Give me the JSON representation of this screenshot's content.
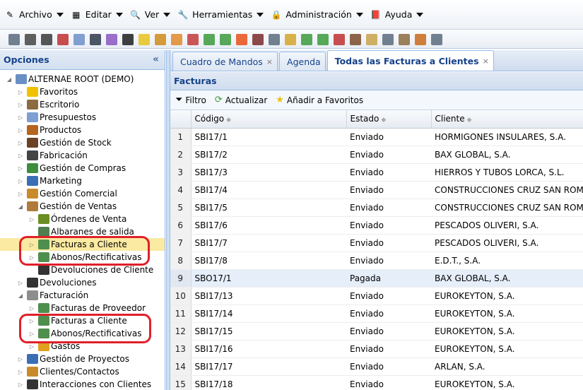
{
  "menubar": [
    {
      "label": "Archivo",
      "icon": "archivo-icon"
    },
    {
      "label": "Editar",
      "icon": "editar-icon"
    },
    {
      "label": "Ver",
      "icon": "ver-icon"
    },
    {
      "label": "Herramientas",
      "icon": "herramientas-icon"
    },
    {
      "label": "Administración",
      "icon": "lock-icon"
    },
    {
      "label": "Ayuda",
      "icon": "book-icon"
    }
  ],
  "left_panel": {
    "title": "Opciones",
    "collapse_glyph": "«"
  },
  "tree": [
    {
      "label": "ALTERNAE ROOT (DEMO)",
      "level": 0,
      "toggle": "◢",
      "icon": "database-icon",
      "color": "#6a8fc4"
    },
    {
      "label": "Favoritos",
      "level": 1,
      "toggle": "▷",
      "icon": "star-icon",
      "color": "#f2c200"
    },
    {
      "label": "Escritorio",
      "level": 1,
      "toggle": "▷",
      "icon": "desk-icon",
      "color": "#8b6b3f"
    },
    {
      "label": "Presupuestos",
      "level": 1,
      "toggle": "▷",
      "icon": "document-icon",
      "color": "#7d9fd1"
    },
    {
      "label": "Productos",
      "level": 1,
      "toggle": "▷",
      "icon": "products-icon",
      "color": "#b5651d"
    },
    {
      "label": "Gestión de Stock",
      "level": 1,
      "toggle": "▷",
      "icon": "stock-icon",
      "color": "#6b4226"
    },
    {
      "label": "Fabricación",
      "level": 1,
      "toggle": "▷",
      "icon": "factory-icon",
      "color": "#444444"
    },
    {
      "label": "Gestión de Compras",
      "level": 1,
      "toggle": "▷",
      "icon": "purchases-icon",
      "color": "#3c8d3c"
    },
    {
      "label": "Marketing",
      "level": 1,
      "toggle": "▷",
      "icon": "marketing-icon",
      "color": "#3a6fb5"
    },
    {
      "label": "Gestión Comercial",
      "level": 1,
      "toggle": "▷",
      "icon": "commercial-icon",
      "color": "#c98b2a"
    },
    {
      "label": "Gestión de Ventas",
      "level": 1,
      "toggle": "◢",
      "icon": "sales-icon",
      "color": "#b07b3a"
    },
    {
      "label": "Órdenes de Venta",
      "level": 2,
      "toggle": "▷",
      "icon": "order-icon",
      "color": "#6b8e23"
    },
    {
      "label": "Albaranes de salida",
      "level": 2,
      "toggle": "",
      "icon": "delivery-icon",
      "color": "#4f7f4f"
    },
    {
      "label": "Facturas a Cliente",
      "level": 2,
      "toggle": "▷",
      "icon": "invoice-icon",
      "color": "#4e8f4e",
      "selected": true
    },
    {
      "label": "Abonos/Rectificativas",
      "level": 2,
      "toggle": "▷",
      "icon": "invoice-icon",
      "color": "#4e8f4e"
    },
    {
      "label": "Devoluciones de Cliente",
      "level": 2,
      "toggle": "",
      "icon": "cart-icon",
      "color": "#333333"
    },
    {
      "label": "Devoluciones",
      "level": 1,
      "toggle": "▷",
      "icon": "cart-icon",
      "color": "#333333"
    },
    {
      "label": "Facturación",
      "level": 1,
      "toggle": "◢",
      "icon": "billing-icon",
      "color": "#8d8d8d"
    },
    {
      "label": "Facturas de Proveedor",
      "level": 2,
      "toggle": "▷",
      "icon": "invoice-icon",
      "color": "#4e8f4e"
    },
    {
      "label": "Facturas a Cliente",
      "level": 2,
      "toggle": "▷",
      "icon": "invoice-icon",
      "color": "#4e8f4e"
    },
    {
      "label": "Abonos/Rectificativas",
      "level": 2,
      "toggle": "▷",
      "icon": "invoice-icon",
      "color": "#4e8f4e"
    },
    {
      "label": "Gastos",
      "level": 2,
      "toggle": "▷",
      "icon": "expenses-icon",
      "color": "#e0a020"
    },
    {
      "label": "Gestión de Proyectos",
      "level": 1,
      "toggle": "▷",
      "icon": "projects-icon",
      "color": "#3a6fb5"
    },
    {
      "label": "Clientes/Contactos",
      "level": 1,
      "toggle": "▷",
      "icon": "contacts-icon",
      "color": "#c98b2a"
    },
    {
      "label": "Interacciones con Clientes",
      "level": 1,
      "toggle": "▷",
      "icon": "interactions-icon",
      "color": "#333333"
    }
  ],
  "tabs": [
    {
      "label": "Cuadro de Mandos",
      "close": "×",
      "active": false
    },
    {
      "label": "Agenda",
      "close": "",
      "active": false
    },
    {
      "label": "Todas las Facturas a Clientes",
      "close": "×",
      "active": true
    }
  ],
  "panel": {
    "title": "Facturas",
    "filter_label": "Filtro",
    "refresh_label": "Actualizar",
    "favorites_label": "Añadir a Favoritos"
  },
  "grid": {
    "columns": [
      "",
      "Código",
      "Estado",
      "Cliente"
    ],
    "rows": [
      {
        "n": "1",
        "codigo": "SBI17/1",
        "estado": "Enviado",
        "cliente": "HORMIGONES INSULARES, S.A."
      },
      {
        "n": "2",
        "codigo": "SBI17/2",
        "estado": "Enviado",
        "cliente": "BAX GLOBAL, S.A."
      },
      {
        "n": "3",
        "codigo": "SBI17/3",
        "estado": "Enviado",
        "cliente": "HIERROS Y TUBOS LORCA, S.L."
      },
      {
        "n": "4",
        "codigo": "SBI17/4",
        "estado": "Enviado",
        "cliente": "CONSTRUCCIONES CRUZ SAN ROMAN, S.A."
      },
      {
        "n": "5",
        "codigo": "SBI17/5",
        "estado": "Enviado",
        "cliente": "CONSTRUCCIONES CRUZ SAN ROMAN, S.A."
      },
      {
        "n": "6",
        "codigo": "SBI17/6",
        "estado": "Enviado",
        "cliente": "PESCADOS OLIVERI, S.A."
      },
      {
        "n": "7",
        "codigo": "SBI17/7",
        "estado": "Enviado",
        "cliente": "PESCADOS OLIVERI, S.A."
      },
      {
        "n": "8",
        "codigo": "SBI17/8",
        "estado": "Enviado",
        "cliente": "E.D.T., S.A."
      },
      {
        "n": "9",
        "codigo": "SBO17/1",
        "estado": "Pagada",
        "cliente": "BAX GLOBAL, S.A.",
        "highlight": true
      },
      {
        "n": "10",
        "codigo": "SBI17/13",
        "estado": "Enviado",
        "cliente": "EUROKEYTON, S.A."
      },
      {
        "n": "11",
        "codigo": "SBI17/14",
        "estado": "Enviado",
        "cliente": "EUROKEYTON, S.A."
      },
      {
        "n": "12",
        "codigo": "SBI17/15",
        "estado": "Enviado",
        "cliente": "EUROKEYTON, S.A."
      },
      {
        "n": "13",
        "codigo": "SBI17/16",
        "estado": "Enviado",
        "cliente": "EUROKEYTON, S.A."
      },
      {
        "n": "14",
        "codigo": "SBI17/17",
        "estado": "Enviado",
        "cliente": "ARLAN, S.A."
      },
      {
        "n": "15",
        "codigo": "SBI17/18",
        "estado": "Enviado",
        "cliente": "EUROKEYTON, S.A."
      }
    ]
  },
  "toolbar_icons": [
    {
      "name": "print-icon",
      "color": "#5a6b7d"
    },
    {
      "name": "cut-icon",
      "color": "#444444"
    },
    {
      "name": "copy-icon",
      "color": "#3a3a3a"
    },
    {
      "name": "calendar-icon",
      "color": "#c03030"
    },
    {
      "name": "document-icon",
      "color": "#6d8fc9"
    },
    {
      "name": "hat-icon",
      "color": "#2e3a4a"
    },
    {
      "name": "book-icon",
      "color": "#8a56c2"
    },
    {
      "name": "users-icon",
      "color": "#1f1f1f"
    },
    {
      "name": "folder-icon",
      "color": "#e7c21e"
    },
    {
      "name": "truck-icon",
      "color": "#d08a1a"
    },
    {
      "name": "box-icon",
      "color": "#e08a2a"
    },
    {
      "name": "monitor-icon",
      "color": "#c23b3b"
    },
    {
      "name": "download-icon",
      "color": "#3c9a3c"
    },
    {
      "name": "upload-icon",
      "color": "#3c9a3c"
    },
    {
      "name": "fire-icon",
      "color": "#e8501a"
    },
    {
      "name": "person-icon",
      "color": "#7a2a2a"
    },
    {
      "name": "calculator-icon",
      "color": "#5a6b7d"
    },
    {
      "name": "coins-icon",
      "color": "#d3a52b"
    },
    {
      "name": "invoice-icon",
      "color": "#3c9a3c"
    },
    {
      "name": "invoice2-icon",
      "color": "#3c9a3c"
    },
    {
      "name": "house-icon",
      "color": "#c03030"
    },
    {
      "name": "user-icon",
      "color": "#7a4a2a"
    },
    {
      "name": "copy2-icon",
      "color": "#c8a24a"
    },
    {
      "name": "mail-icon",
      "color": "#5a6b7d"
    },
    {
      "name": "box2-icon",
      "color": "#8b6b3f"
    },
    {
      "name": "bug-icon",
      "color": "#c86a1a"
    },
    {
      "name": "gear-icon",
      "color": "#5a6b7d"
    }
  ]
}
